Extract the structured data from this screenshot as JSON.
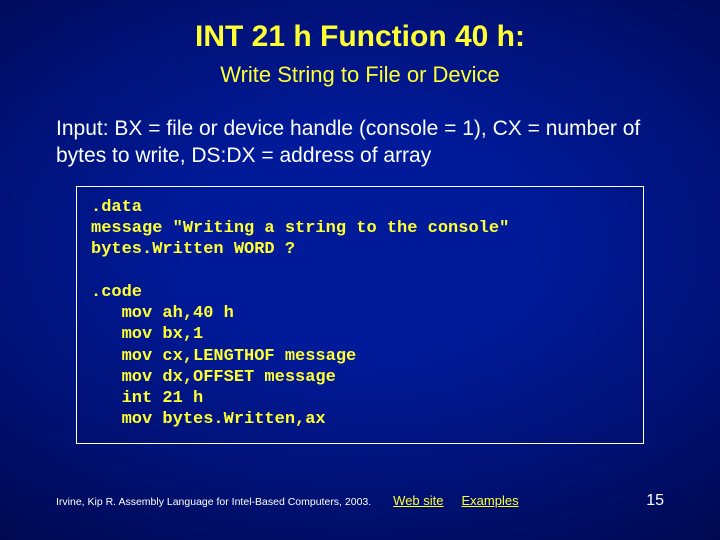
{
  "title": "INT 21 h Function 40 h:",
  "subtitle": "Write String to File or Device",
  "input_desc": "Input: BX = file or device handle (console = 1), CX = number of bytes to write, DS:DX = address of array",
  "code": ".data\nmessage \"Writing a string to the console\"\nbytes.Written WORD ?\n\n.code\n   mov ah,40 h\n   mov bx,1\n   mov cx,LENGTHOF message\n   mov dx,OFFSET message\n   int 21 h\n   mov bytes.Written,ax",
  "footer": {
    "citation": "Irvine, Kip R. Assembly Language for Intel-Based Computers, 2003.",
    "link_web": "Web site",
    "link_examples": "Examples",
    "page": "15"
  }
}
